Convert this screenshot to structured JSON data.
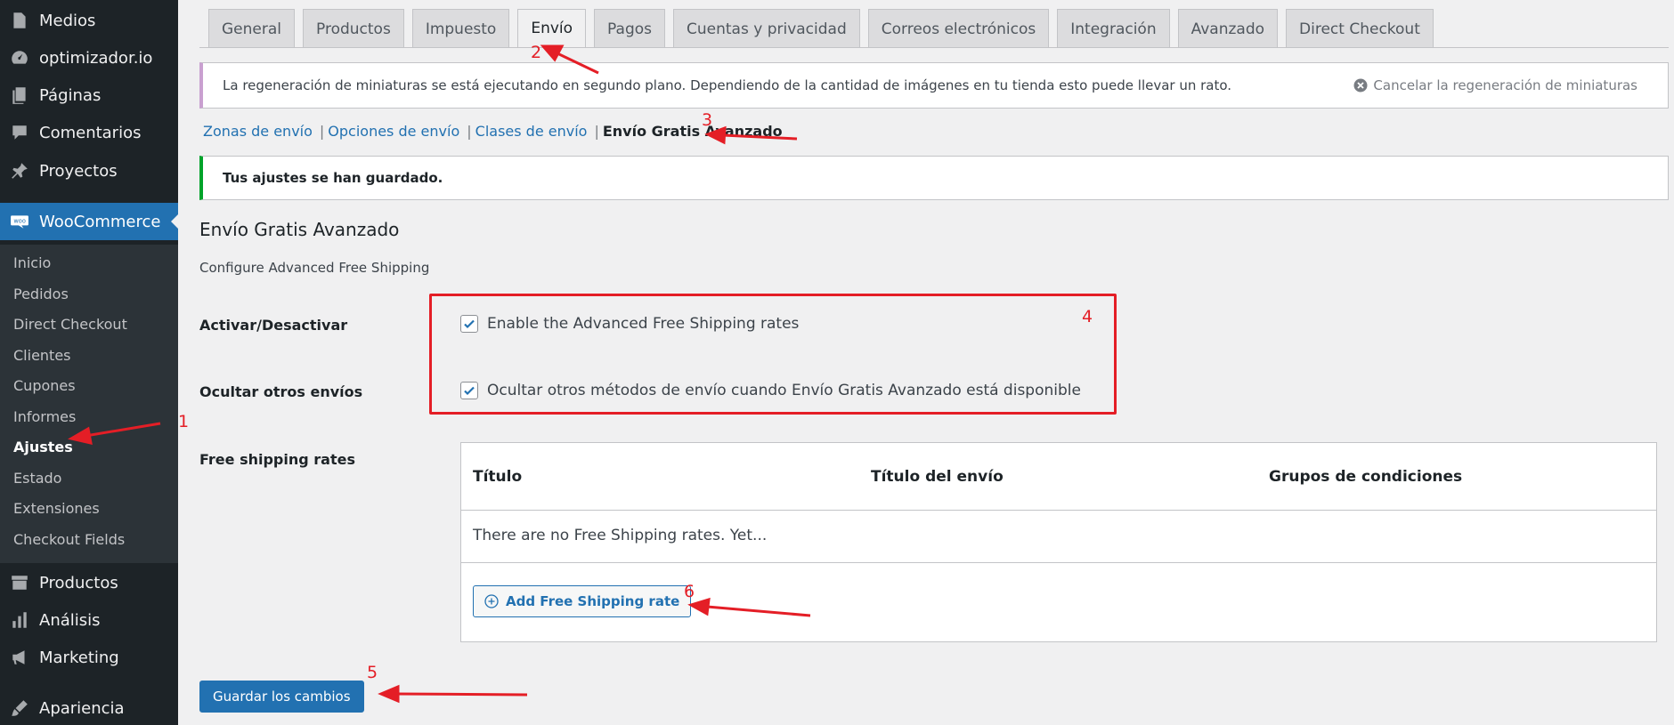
{
  "sidebar": {
    "items": [
      {
        "label": "Medios",
        "icon": "media-icon"
      },
      {
        "label": "optimizador.io",
        "icon": "gauge-icon"
      },
      {
        "label": "Páginas",
        "icon": "pages-icon"
      },
      {
        "label": "Comentarios",
        "icon": "comment-icon"
      },
      {
        "label": "Proyectos",
        "icon": "pin-icon"
      }
    ],
    "woocommerce": {
      "label": "WooCommerce",
      "icon": "woo-icon"
    },
    "submenu": [
      "Inicio",
      "Pedidos",
      "Direct Checkout",
      "Clientes",
      "Cupones",
      "Informes",
      "Ajustes",
      "Estado",
      "Extensiones",
      "Checkout Fields"
    ],
    "submenu_current": "Ajustes",
    "bottom_items": [
      {
        "label": "Productos",
        "icon": "archive-icon"
      },
      {
        "label": "Análisis",
        "icon": "bar-chart-icon"
      },
      {
        "label": "Marketing",
        "icon": "megaphone-icon"
      },
      {
        "label": "Apariencia",
        "icon": "brush-icon"
      }
    ]
  },
  "tabs": [
    "General",
    "Productos",
    "Impuesto",
    "Envío",
    "Pagos",
    "Cuentas y privacidad",
    "Correos electrónicos",
    "Integración",
    "Avanzado",
    "Direct Checkout"
  ],
  "active_tab": "Envío",
  "notice_regen": {
    "text": "La regeneración de miniaturas se está ejecutando en segundo plano. Dependiendo de la cantidad de imágenes en tu tienda esto puede llevar un rato.",
    "cancel": "Cancelar la regeneración de miniaturas"
  },
  "subsubsub": {
    "links": [
      "Zonas de envío",
      "Opciones de envío",
      "Clases de envío"
    ],
    "separator": "|",
    "current": "Envío Gratis Avanzado"
  },
  "notice_saved": "Tus ajustes se han guardado.",
  "section": {
    "title": "Envío Gratis Avanzado",
    "description": "Configure Advanced Free Shipping"
  },
  "settings": {
    "enable": {
      "label": "Activar/Desactivar",
      "checkbox": "Enable the Advanced Free Shipping rates",
      "checked": true
    },
    "hide": {
      "label": "Ocultar otros envíos",
      "checkbox": "Ocultar otros métodos de envío cuando Envío Gratis Avanzado está disponible",
      "checked": true
    },
    "rates": {
      "label": "Free shipping rates"
    }
  },
  "table": {
    "columns": [
      "Título",
      "Título del envío",
      "Grupos de condiciones"
    ],
    "empty": "There are no Free Shipping rates. Yet...",
    "add_button": "Add Free Shipping rate"
  },
  "save_button": "Guardar los cambios",
  "annotations": [
    "1",
    "2",
    "3",
    "4",
    "5",
    "6"
  ],
  "colors": {
    "accent": "#2271b1",
    "sidebar": "#1d2327",
    "annotation": "#e41e26",
    "success": "#00a32a"
  }
}
